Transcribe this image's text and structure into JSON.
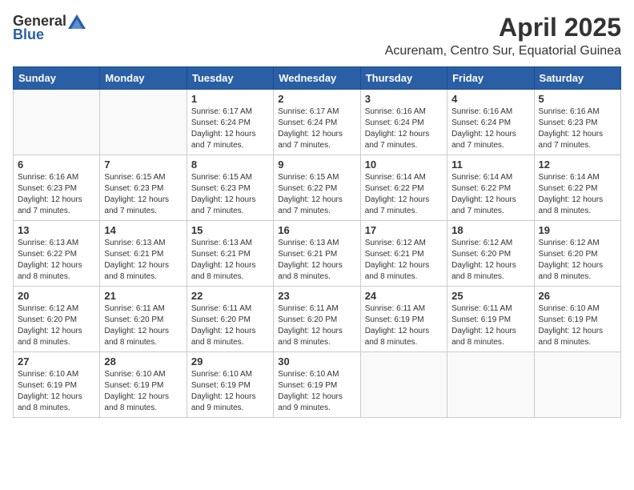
{
  "header": {
    "logo_general": "General",
    "logo_blue": "Blue",
    "title": "April 2025",
    "subtitle": "Acurenam, Centro Sur, Equatorial Guinea"
  },
  "days_of_week": [
    "Sunday",
    "Monday",
    "Tuesday",
    "Wednesday",
    "Thursday",
    "Friday",
    "Saturday"
  ],
  "weeks": [
    [
      {
        "day": "",
        "info": ""
      },
      {
        "day": "",
        "info": ""
      },
      {
        "day": "1",
        "info": "Sunrise: 6:17 AM\nSunset: 6:24 PM\nDaylight: 12 hours and 7 minutes."
      },
      {
        "day": "2",
        "info": "Sunrise: 6:17 AM\nSunset: 6:24 PM\nDaylight: 12 hours and 7 minutes."
      },
      {
        "day": "3",
        "info": "Sunrise: 6:16 AM\nSunset: 6:24 PM\nDaylight: 12 hours and 7 minutes."
      },
      {
        "day": "4",
        "info": "Sunrise: 6:16 AM\nSunset: 6:24 PM\nDaylight: 12 hours and 7 minutes."
      },
      {
        "day": "5",
        "info": "Sunrise: 6:16 AM\nSunset: 6:23 PM\nDaylight: 12 hours and 7 minutes."
      }
    ],
    [
      {
        "day": "6",
        "info": "Sunrise: 6:16 AM\nSunset: 6:23 PM\nDaylight: 12 hours and 7 minutes."
      },
      {
        "day": "7",
        "info": "Sunrise: 6:15 AM\nSunset: 6:23 PM\nDaylight: 12 hours and 7 minutes."
      },
      {
        "day": "8",
        "info": "Sunrise: 6:15 AM\nSunset: 6:23 PM\nDaylight: 12 hours and 7 minutes."
      },
      {
        "day": "9",
        "info": "Sunrise: 6:15 AM\nSunset: 6:22 PM\nDaylight: 12 hours and 7 minutes."
      },
      {
        "day": "10",
        "info": "Sunrise: 6:14 AM\nSunset: 6:22 PM\nDaylight: 12 hours and 7 minutes."
      },
      {
        "day": "11",
        "info": "Sunrise: 6:14 AM\nSunset: 6:22 PM\nDaylight: 12 hours and 7 minutes."
      },
      {
        "day": "12",
        "info": "Sunrise: 6:14 AM\nSunset: 6:22 PM\nDaylight: 12 hours and 8 minutes."
      }
    ],
    [
      {
        "day": "13",
        "info": "Sunrise: 6:13 AM\nSunset: 6:22 PM\nDaylight: 12 hours and 8 minutes."
      },
      {
        "day": "14",
        "info": "Sunrise: 6:13 AM\nSunset: 6:21 PM\nDaylight: 12 hours and 8 minutes."
      },
      {
        "day": "15",
        "info": "Sunrise: 6:13 AM\nSunset: 6:21 PM\nDaylight: 12 hours and 8 minutes."
      },
      {
        "day": "16",
        "info": "Sunrise: 6:13 AM\nSunset: 6:21 PM\nDaylight: 12 hours and 8 minutes."
      },
      {
        "day": "17",
        "info": "Sunrise: 6:12 AM\nSunset: 6:21 PM\nDaylight: 12 hours and 8 minutes."
      },
      {
        "day": "18",
        "info": "Sunrise: 6:12 AM\nSunset: 6:20 PM\nDaylight: 12 hours and 8 minutes."
      },
      {
        "day": "19",
        "info": "Sunrise: 6:12 AM\nSunset: 6:20 PM\nDaylight: 12 hours and 8 minutes."
      }
    ],
    [
      {
        "day": "20",
        "info": "Sunrise: 6:12 AM\nSunset: 6:20 PM\nDaylight: 12 hours and 8 minutes."
      },
      {
        "day": "21",
        "info": "Sunrise: 6:11 AM\nSunset: 6:20 PM\nDaylight: 12 hours and 8 minutes."
      },
      {
        "day": "22",
        "info": "Sunrise: 6:11 AM\nSunset: 6:20 PM\nDaylight: 12 hours and 8 minutes."
      },
      {
        "day": "23",
        "info": "Sunrise: 6:11 AM\nSunset: 6:20 PM\nDaylight: 12 hours and 8 minutes."
      },
      {
        "day": "24",
        "info": "Sunrise: 6:11 AM\nSunset: 6:19 PM\nDaylight: 12 hours and 8 minutes."
      },
      {
        "day": "25",
        "info": "Sunrise: 6:11 AM\nSunset: 6:19 PM\nDaylight: 12 hours and 8 minutes."
      },
      {
        "day": "26",
        "info": "Sunrise: 6:10 AM\nSunset: 6:19 PM\nDaylight: 12 hours and 8 minutes."
      }
    ],
    [
      {
        "day": "27",
        "info": "Sunrise: 6:10 AM\nSunset: 6:19 PM\nDaylight: 12 hours and 8 minutes."
      },
      {
        "day": "28",
        "info": "Sunrise: 6:10 AM\nSunset: 6:19 PM\nDaylight: 12 hours and 8 minutes."
      },
      {
        "day": "29",
        "info": "Sunrise: 6:10 AM\nSunset: 6:19 PM\nDaylight: 12 hours and 9 minutes."
      },
      {
        "day": "30",
        "info": "Sunrise: 6:10 AM\nSunset: 6:19 PM\nDaylight: 12 hours and 9 minutes."
      },
      {
        "day": "",
        "info": ""
      },
      {
        "day": "",
        "info": ""
      },
      {
        "day": "",
        "info": ""
      }
    ]
  ]
}
